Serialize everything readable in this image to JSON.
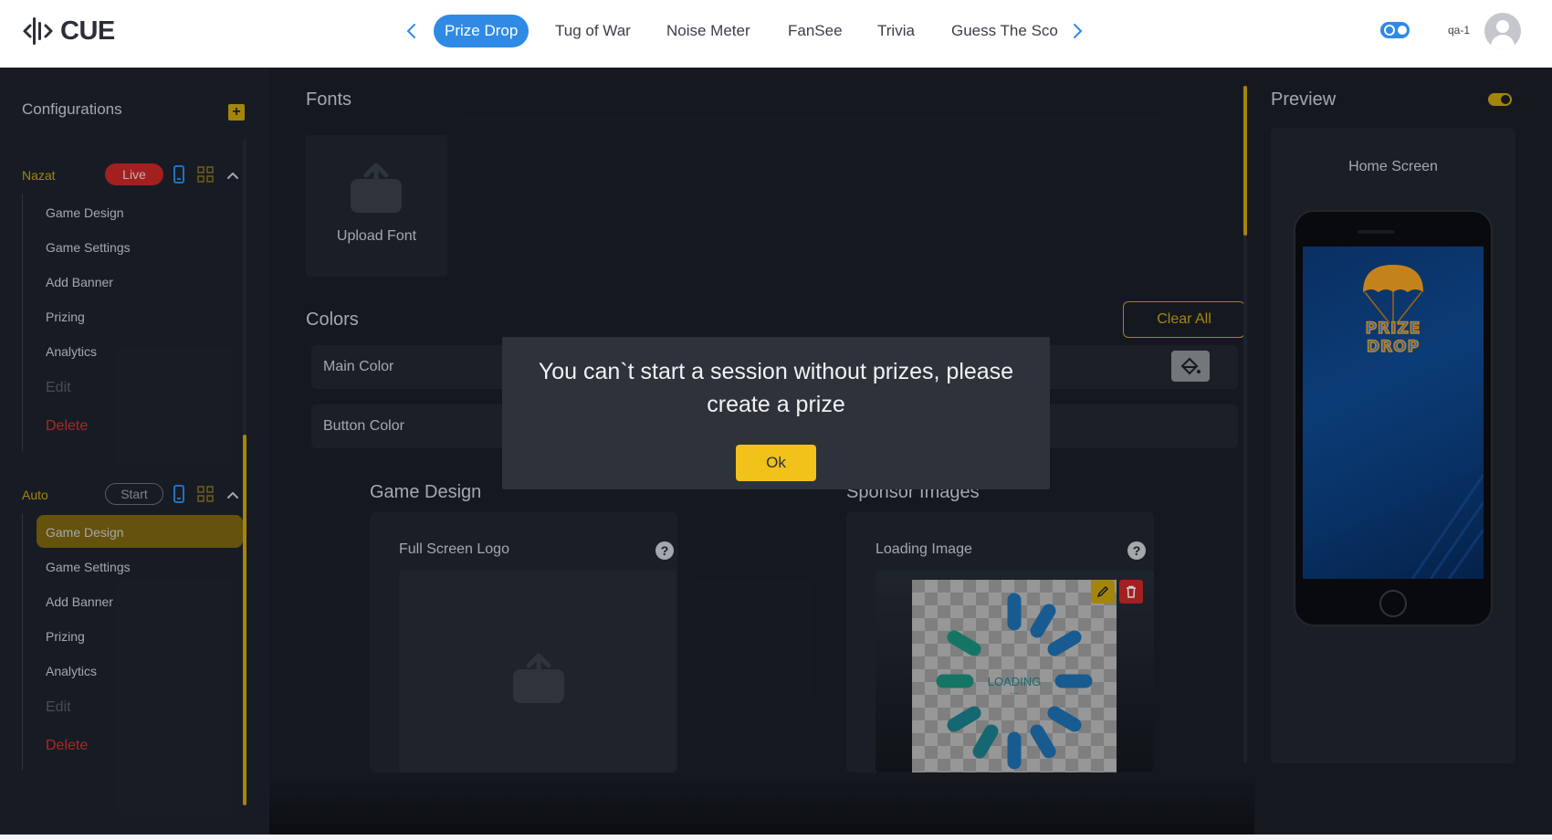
{
  "header": {
    "logo_text": "CUE",
    "tabs": [
      {
        "label": "Prize Drop",
        "active": true
      },
      {
        "label": "Tug of War"
      },
      {
        "label": "Noise Meter"
      },
      {
        "label": "FanSee"
      },
      {
        "label": "Trivia"
      },
      {
        "label": "Guess The Sco"
      }
    ],
    "username": "qa-1",
    "accent_color": "#2f8ae5"
  },
  "sidebar": {
    "title": "Configurations",
    "configs": [
      {
        "name": "Nazat",
        "status": "Live",
        "items": [
          "Game Design",
          "Game Settings",
          "Add Banner",
          "Prizing",
          "Analytics"
        ],
        "edit_label": "Edit",
        "delete_label": "Delete"
      },
      {
        "name": "Auto",
        "status": "Start",
        "active_item": "Game Design",
        "items": [
          "Game Design",
          "Game Settings",
          "Add Banner",
          "Prizing",
          "Analytics"
        ],
        "edit_label": "Edit",
        "delete_label": "Delete"
      }
    ],
    "accent_color": "#c9a30f",
    "delete_color": "#d32f2f"
  },
  "main": {
    "fonts_title": "Fonts",
    "upload_font_label": "Upload Font",
    "colors_title": "Colors",
    "clear_all_label": "Clear All",
    "color_rows": [
      "Main Color",
      "Button Color"
    ],
    "game_design_title": "Game Design",
    "sponsor_images_title": "Sponsor Images",
    "full_screen_logo_label": "Full Screen Logo",
    "loading_image_label": "Loading Image",
    "loading_text": "LOADING",
    "loading_dots": "..."
  },
  "preview": {
    "title": "Preview",
    "screen_label": "Home Screen",
    "logo_line1": "PRIZE",
    "logo_line2": "DROP"
  },
  "modal": {
    "message": "You can`t start a session without prizes, please create a prize",
    "ok_label": "Ok",
    "button_color": "#f0c21a"
  }
}
